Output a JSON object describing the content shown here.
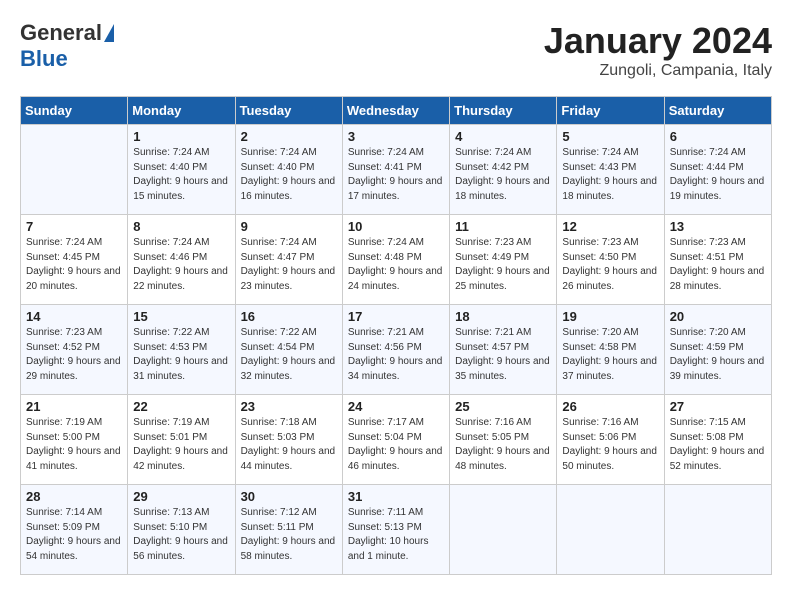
{
  "header": {
    "logo_general": "General",
    "logo_blue": "Blue",
    "month_title": "January 2024",
    "location": "Zungoli, Campania, Italy"
  },
  "weekdays": [
    "Sunday",
    "Monday",
    "Tuesday",
    "Wednesday",
    "Thursday",
    "Friday",
    "Saturday"
  ],
  "weeks": [
    [
      {
        "day": "",
        "sunrise": "",
        "sunset": "",
        "daylight": ""
      },
      {
        "day": "1",
        "sunrise": "Sunrise: 7:24 AM",
        "sunset": "Sunset: 4:40 PM",
        "daylight": "Daylight: 9 hours and 15 minutes."
      },
      {
        "day": "2",
        "sunrise": "Sunrise: 7:24 AM",
        "sunset": "Sunset: 4:40 PM",
        "daylight": "Daylight: 9 hours and 16 minutes."
      },
      {
        "day": "3",
        "sunrise": "Sunrise: 7:24 AM",
        "sunset": "Sunset: 4:41 PM",
        "daylight": "Daylight: 9 hours and 17 minutes."
      },
      {
        "day": "4",
        "sunrise": "Sunrise: 7:24 AM",
        "sunset": "Sunset: 4:42 PM",
        "daylight": "Daylight: 9 hours and 18 minutes."
      },
      {
        "day": "5",
        "sunrise": "Sunrise: 7:24 AM",
        "sunset": "Sunset: 4:43 PM",
        "daylight": "Daylight: 9 hours and 18 minutes."
      },
      {
        "day": "6",
        "sunrise": "Sunrise: 7:24 AM",
        "sunset": "Sunset: 4:44 PM",
        "daylight": "Daylight: 9 hours and 19 minutes."
      }
    ],
    [
      {
        "day": "7",
        "sunrise": "Sunrise: 7:24 AM",
        "sunset": "Sunset: 4:45 PM",
        "daylight": "Daylight: 9 hours and 20 minutes."
      },
      {
        "day": "8",
        "sunrise": "Sunrise: 7:24 AM",
        "sunset": "Sunset: 4:46 PM",
        "daylight": "Daylight: 9 hours and 22 minutes."
      },
      {
        "day": "9",
        "sunrise": "Sunrise: 7:24 AM",
        "sunset": "Sunset: 4:47 PM",
        "daylight": "Daylight: 9 hours and 23 minutes."
      },
      {
        "day": "10",
        "sunrise": "Sunrise: 7:24 AM",
        "sunset": "Sunset: 4:48 PM",
        "daylight": "Daylight: 9 hours and 24 minutes."
      },
      {
        "day": "11",
        "sunrise": "Sunrise: 7:23 AM",
        "sunset": "Sunset: 4:49 PM",
        "daylight": "Daylight: 9 hours and 25 minutes."
      },
      {
        "day": "12",
        "sunrise": "Sunrise: 7:23 AM",
        "sunset": "Sunset: 4:50 PM",
        "daylight": "Daylight: 9 hours and 26 minutes."
      },
      {
        "day": "13",
        "sunrise": "Sunrise: 7:23 AM",
        "sunset": "Sunset: 4:51 PM",
        "daylight": "Daylight: 9 hours and 28 minutes."
      }
    ],
    [
      {
        "day": "14",
        "sunrise": "Sunrise: 7:23 AM",
        "sunset": "Sunset: 4:52 PM",
        "daylight": "Daylight: 9 hours and 29 minutes."
      },
      {
        "day": "15",
        "sunrise": "Sunrise: 7:22 AM",
        "sunset": "Sunset: 4:53 PM",
        "daylight": "Daylight: 9 hours and 31 minutes."
      },
      {
        "day": "16",
        "sunrise": "Sunrise: 7:22 AM",
        "sunset": "Sunset: 4:54 PM",
        "daylight": "Daylight: 9 hours and 32 minutes."
      },
      {
        "day": "17",
        "sunrise": "Sunrise: 7:21 AM",
        "sunset": "Sunset: 4:56 PM",
        "daylight": "Daylight: 9 hours and 34 minutes."
      },
      {
        "day": "18",
        "sunrise": "Sunrise: 7:21 AM",
        "sunset": "Sunset: 4:57 PM",
        "daylight": "Daylight: 9 hours and 35 minutes."
      },
      {
        "day": "19",
        "sunrise": "Sunrise: 7:20 AM",
        "sunset": "Sunset: 4:58 PM",
        "daylight": "Daylight: 9 hours and 37 minutes."
      },
      {
        "day": "20",
        "sunrise": "Sunrise: 7:20 AM",
        "sunset": "Sunset: 4:59 PM",
        "daylight": "Daylight: 9 hours and 39 minutes."
      }
    ],
    [
      {
        "day": "21",
        "sunrise": "Sunrise: 7:19 AM",
        "sunset": "Sunset: 5:00 PM",
        "daylight": "Daylight: 9 hours and 41 minutes."
      },
      {
        "day": "22",
        "sunrise": "Sunrise: 7:19 AM",
        "sunset": "Sunset: 5:01 PM",
        "daylight": "Daylight: 9 hours and 42 minutes."
      },
      {
        "day": "23",
        "sunrise": "Sunrise: 7:18 AM",
        "sunset": "Sunset: 5:03 PM",
        "daylight": "Daylight: 9 hours and 44 minutes."
      },
      {
        "day": "24",
        "sunrise": "Sunrise: 7:17 AM",
        "sunset": "Sunset: 5:04 PM",
        "daylight": "Daylight: 9 hours and 46 minutes."
      },
      {
        "day": "25",
        "sunrise": "Sunrise: 7:16 AM",
        "sunset": "Sunset: 5:05 PM",
        "daylight": "Daylight: 9 hours and 48 minutes."
      },
      {
        "day": "26",
        "sunrise": "Sunrise: 7:16 AM",
        "sunset": "Sunset: 5:06 PM",
        "daylight": "Daylight: 9 hours and 50 minutes."
      },
      {
        "day": "27",
        "sunrise": "Sunrise: 7:15 AM",
        "sunset": "Sunset: 5:08 PM",
        "daylight": "Daylight: 9 hours and 52 minutes."
      }
    ],
    [
      {
        "day": "28",
        "sunrise": "Sunrise: 7:14 AM",
        "sunset": "Sunset: 5:09 PM",
        "daylight": "Daylight: 9 hours and 54 minutes."
      },
      {
        "day": "29",
        "sunrise": "Sunrise: 7:13 AM",
        "sunset": "Sunset: 5:10 PM",
        "daylight": "Daylight: 9 hours and 56 minutes."
      },
      {
        "day": "30",
        "sunrise": "Sunrise: 7:12 AM",
        "sunset": "Sunset: 5:11 PM",
        "daylight": "Daylight: 9 hours and 58 minutes."
      },
      {
        "day": "31",
        "sunrise": "Sunrise: 7:11 AM",
        "sunset": "Sunset: 5:13 PM",
        "daylight": "Daylight: 10 hours and 1 minute."
      },
      {
        "day": "",
        "sunrise": "",
        "sunset": "",
        "daylight": ""
      },
      {
        "day": "",
        "sunrise": "",
        "sunset": "",
        "daylight": ""
      },
      {
        "day": "",
        "sunrise": "",
        "sunset": "",
        "daylight": ""
      }
    ]
  ]
}
